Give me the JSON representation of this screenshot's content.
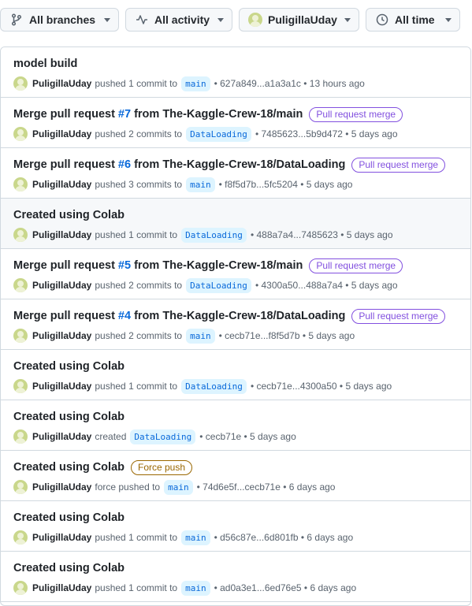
{
  "filters": {
    "branches": "All branches",
    "activity": "All activity",
    "user": "PuligillaUday",
    "time": "All time"
  },
  "items": [
    {
      "title": "model build",
      "user": "PuligillaUday",
      "action": "pushed 1 commit to",
      "branch": "main",
      "range": "627a849...a1a3a1c",
      "time": "13 hours ago"
    },
    {
      "title_pre": "Merge pull request",
      "num": "#7",
      "title_post": "from The-Kaggle-Crew-18/main",
      "badge": "Pull request merge",
      "user": "PuligillaUday",
      "action": "pushed 2 commits to",
      "branch": "DataLoading",
      "range": "7485623...5b9d472",
      "time": "5 days ago"
    },
    {
      "title_pre": "Merge pull request",
      "num": "#6",
      "title_post": "from The-Kaggle-Crew-18/DataLoading",
      "badge": "Pull request merge",
      "user": "PuligillaUday",
      "action": "pushed 3 commits to",
      "branch": "main",
      "range": "f8f5d7b...5fc5204",
      "time": "5 days ago"
    },
    {
      "title": "Created using Colab",
      "user": "PuligillaUday",
      "action": "pushed 1 commit to",
      "branch": "DataLoading",
      "range": "488a7a4...7485623",
      "time": "5 days ago"
    },
    {
      "title_pre": "Merge pull request",
      "num": "#5",
      "title_post": "from The-Kaggle-Crew-18/main",
      "badge": "Pull request merge",
      "user": "PuligillaUday",
      "action": "pushed 2 commits to",
      "branch": "DataLoading",
      "range": "4300a50...488a7a4",
      "time": "5 days ago"
    },
    {
      "title_pre": "Merge pull request",
      "num": "#4",
      "title_post": "from The-Kaggle-Crew-18/DataLoading",
      "badge": "Pull request merge",
      "user": "PuligillaUday",
      "action": "pushed 2 commits to",
      "branch": "main",
      "range": "cecb71e...f8f5d7b",
      "time": "5 days ago"
    },
    {
      "title": "Created using Colab",
      "user": "PuligillaUday",
      "action": "pushed 1 commit to",
      "branch": "DataLoading",
      "range": "cecb71e...4300a50",
      "time": "5 days ago"
    },
    {
      "title": "Created using Colab",
      "user": "PuligillaUday",
      "action": "created",
      "branch": "DataLoading",
      "range": "cecb71e",
      "time": "5 days ago"
    },
    {
      "title": "Created using Colab",
      "badge2": "Force push",
      "user": "PuligillaUday",
      "action": "force pushed to",
      "branch": "main",
      "range": "74d6e5f...cecb71e",
      "time": "6 days ago"
    },
    {
      "title": "Created using Colab",
      "user": "PuligillaUday",
      "action": "pushed 1 commit to",
      "branch": "main",
      "range": "d56c87e...6d801fb",
      "time": "6 days ago"
    },
    {
      "title": "Created using Colab",
      "user": "PuligillaUday",
      "action": "pushed 1 commit to",
      "branch": "main",
      "range": "ad0a3e1...6ed76e5",
      "time": "6 days ago"
    }
  ]
}
